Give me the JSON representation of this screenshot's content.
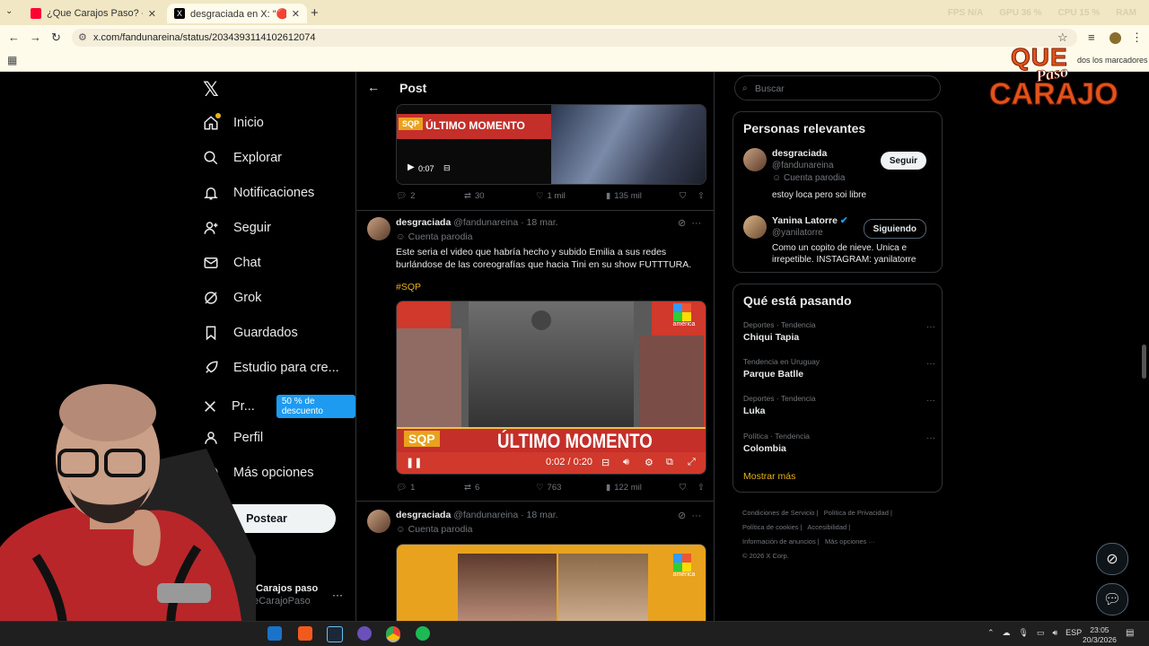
{
  "browser": {
    "tabs": [
      {
        "title": "¿Que Carajos Paso? - YouTube",
        "active": false
      },
      {
        "title": "desgraciada en X: \"🔴ABRO",
        "active": true
      }
    ],
    "url": "x.com/fandunareina/status/2034393114102612074",
    "perf": [
      "FPS N/A",
      "GPU 36 %",
      "CPU 15 %",
      "RAM"
    ],
    "bookmarks_label": "dos los marcadores"
  },
  "logo": {
    "line1": "QUE",
    "line2": "Paso",
    "line3": "CARAJO"
  },
  "nav": {
    "items": [
      {
        "label": "Inicio",
        "icon": "home-icon"
      },
      {
        "label": "Explorar",
        "icon": "search-icon"
      },
      {
        "label": "Notificaciones",
        "icon": "bell-icon"
      },
      {
        "label": "Seguir",
        "icon": "add-person-icon"
      },
      {
        "label": "Chat",
        "icon": "mail-icon"
      },
      {
        "label": "Grok",
        "icon": "grok-icon"
      },
      {
        "label": "Guardados",
        "icon": "bookmark-icon"
      },
      {
        "label": "Estudio para cre...",
        "icon": "rocket-icon"
      },
      {
        "label": "Pr...",
        "icon": "x-premium-icon"
      },
      {
        "label": "Perfil",
        "icon": "person-icon"
      },
      {
        "label": "Más opciones",
        "icon": "more-circle-icon"
      }
    ],
    "premium_badge": "50 % de descuento",
    "post_button": "Postear",
    "account_name": "e Carajos paso",
    "account_handle": "ueCarajoPaso",
    "account_more": "···"
  },
  "post_header": {
    "title": "Post",
    "back": "←"
  },
  "tweet0": {
    "media_label": "ÚLTIMO MOMENTO",
    "media_tag": "SQP",
    "video_time": "0:07",
    "replies": "2",
    "reposts": "30",
    "likes": "1 mil",
    "views": "135 mil"
  },
  "tweet1": {
    "name": "desgraciada",
    "handle": "@fandunareina",
    "date": "· 18 mar.",
    "badge": "Cuenta parodia",
    "text": "Este seria el video que habría hecho y subido Emilia a sus redes burlándose de las coreografías que hacia Tini en su show FUTTTURA.",
    "hashtag": "#SQP",
    "video_banner": "ÚLTIMO MOMENTO",
    "video_tag": "SQP",
    "channel": "américa",
    "video_time": "0:02 / 0:20",
    "replies": "1",
    "reposts": "6",
    "likes": "763",
    "views": "122 mil"
  },
  "tweet2": {
    "name": "desgraciada",
    "handle": "@fandunareina",
    "date": "· 18 mar.",
    "badge": "Cuenta parodia",
    "channel": "américa"
  },
  "search": {
    "placeholder": "Buscar"
  },
  "relevant": {
    "title": "Personas relevantes",
    "people": [
      {
        "name": "desgraciada",
        "handle": "@fandunareina",
        "badge": "Cuenta parodia",
        "bio": "estoy loca pero soi libre",
        "button": "Seguir"
      },
      {
        "name": "Yanina Latorre",
        "handle": "@yanilatorre",
        "bio": "Como un copito de nieve. Unica e irrepetible. INSTAGRAM: yanilatorre",
        "button": "Siguiendo",
        "verified": true
      }
    ]
  },
  "trends": {
    "title": "Qué está pasando",
    "items": [
      {
        "category": "Deportes · Tendencia",
        "name": "Chiqui Tapia"
      },
      {
        "category": "Tendencia en Uruguay",
        "name": "Parque Batlle"
      },
      {
        "category": "Deportes · Tendencia",
        "name": "Luka"
      },
      {
        "category": "Política · Tendencia",
        "name": "Colombia"
      }
    ],
    "more": "Mostrar más"
  },
  "footer": {
    "links": [
      "Condiciones de Servicio",
      "Política de Privacidad",
      "Política de cookies",
      "Accesibilidad",
      "Información de anuncios",
      "Más opciones ···"
    ],
    "copyright": "© 2026 X Corp."
  },
  "taskbar": {
    "lang": "ESP",
    "time": "23:05",
    "date": "20/3/2026"
  },
  "colors": {
    "accent": "#e7b416",
    "bg": "#000000",
    "text": "#e7e9ea",
    "muted": "#71767b",
    "border": "#2f3336"
  }
}
